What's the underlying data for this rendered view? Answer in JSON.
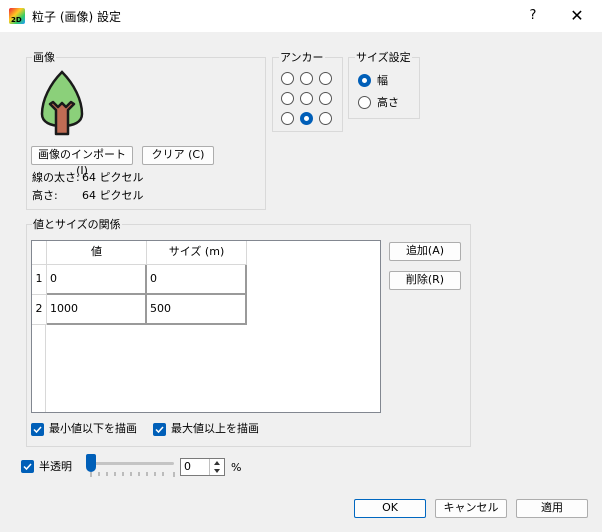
{
  "window": {
    "title": "粒子 (画像) 設定",
    "app_icon_text": "2D",
    "help": "?",
    "close": "✕"
  },
  "image_group": {
    "label": "画像",
    "import_button": "画像のインポート (I)",
    "clear_button": "クリア (C)",
    "line_width_label": "線の太さ:",
    "line_width_value": "64 ピクセル",
    "height_label": "高さ:",
    "height_value": "64 ピクセル"
  },
  "anchor_group": {
    "label": "アンカー",
    "selected_index": 7
  },
  "size_group": {
    "label": "サイズ設定",
    "options": [
      "幅",
      "高さ"
    ],
    "selected": 0
  },
  "relation_group": {
    "label": "値とサイズの関係",
    "columns": [
      "値",
      "サイズ (m)"
    ],
    "rows": [
      {
        "num": "1",
        "value": "0",
        "size": "0"
      },
      {
        "num": "2",
        "value": "1000",
        "size": "500"
      }
    ],
    "add_button": "追加(A)",
    "delete_button": "削除(R)",
    "draw_below_min": "最小値以下を描画",
    "draw_above_max": "最大値以上を描画"
  },
  "transparency": {
    "label": "半透明",
    "value": "0",
    "unit": "%",
    "slider_value": 0
  },
  "footer": {
    "ok": "OK",
    "cancel": "キャンセル",
    "apply": "適用"
  }
}
